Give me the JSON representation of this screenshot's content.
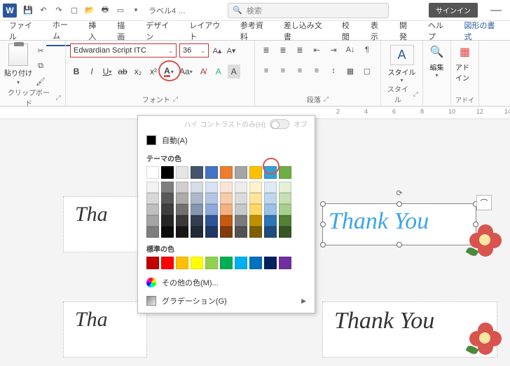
{
  "titlebar": {
    "app_letter": "W",
    "doc_title": "ラベル4 …",
    "search_placeholder": "検索",
    "signin": "サインイン"
  },
  "tabs": {
    "file": "ファイル",
    "home": "ホーム",
    "insert": "挿入",
    "draw": "描画",
    "design": "デザイン",
    "layout": "レイアウト",
    "references": "参考資料",
    "mailings": "差し込み文書",
    "review": "校閲",
    "display": "表示",
    "developer": "開発",
    "help": "ヘルプ",
    "format": "図形の書式"
  },
  "ribbon": {
    "clipboard": {
      "paste": "貼り付け",
      "group": "クリップボード"
    },
    "font": {
      "name": "Edwardian Script ITC",
      "size": "36",
      "group": "フォント",
      "bold": "B",
      "italic": "I",
      "under": "U",
      "strike": "ab",
      "sub": "x₂",
      "sup": "x²",
      "aa": "Aa",
      "a_big": "A",
      "a_small": "A",
      "a_box": "A"
    },
    "paragraph": {
      "group": "段落"
    },
    "styles": {
      "label": "スタイル",
      "group": "スタイル"
    },
    "editing": {
      "label": "編集"
    },
    "addins": {
      "label": "アドイン",
      "group": "アドイ"
    }
  },
  "color_popup": {
    "high_contrast": "ハイ コントラストのみ(H)",
    "hc_state": "オフ",
    "auto": "自動(A)",
    "theme_label": "テーマの色",
    "theme_row": [
      "#ffffff",
      "#000000",
      "#e7e6e6",
      "#44546a",
      "#4472c4",
      "#ed7d31",
      "#a5a5a5",
      "#ffc000",
      "#33a0dc",
      "#70ad47"
    ],
    "shades": [
      [
        "#f2f2f2",
        "#7f7f7f",
        "#d0cece",
        "#d6dce4",
        "#d9e2f3",
        "#fbe5d5",
        "#ededed",
        "#fff2cc",
        "#deebf6",
        "#e2efd9"
      ],
      [
        "#d8d8d8",
        "#595959",
        "#aeabab",
        "#adb9ca",
        "#b4c6e7",
        "#f7cbac",
        "#dbdbdb",
        "#fee599",
        "#bdd7ee",
        "#c5e0b3"
      ],
      [
        "#bfbfbf",
        "#3f3f3f",
        "#757070",
        "#8496b0",
        "#8eaadb",
        "#f4b183",
        "#c9c9c9",
        "#ffd965",
        "#9cc3e5",
        "#a8d08d"
      ],
      [
        "#a5a5a5",
        "#262626",
        "#3a3838",
        "#323f4f",
        "#2f5496",
        "#c55a11",
        "#7b7b7b",
        "#bf9000",
        "#2e75b5",
        "#538135"
      ],
      [
        "#7f7f7f",
        "#0c0c0c",
        "#171616",
        "#222a35",
        "#1f3864",
        "#833c0b",
        "#525252",
        "#7f6000",
        "#1e4e79",
        "#375623"
      ]
    ],
    "standard_label": "標準の色",
    "standard": [
      "#c00000",
      "#ff0000",
      "#ffc000",
      "#ffff00",
      "#92d050",
      "#00b050",
      "#00b0f0",
      "#0070c0",
      "#002060",
      "#7030a0"
    ],
    "more": "その他の色(M)...",
    "gradient": "グラデーション(G)"
  },
  "canvas": {
    "text": "Thank You",
    "ruler_marks": [
      "2",
      "4",
      "6",
      "8",
      "10",
      "12",
      "14"
    ]
  }
}
